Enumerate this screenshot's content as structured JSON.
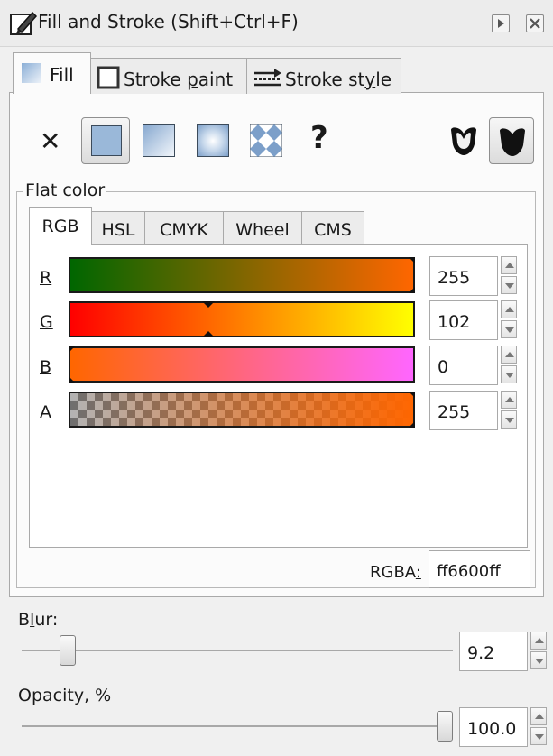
{
  "window": {
    "title": "Fill and Stroke (Shift+Ctrl+F)",
    "title_icon": "fill-stroke-pen-icon",
    "controls": [
      "dock-arrow-icon",
      "close-icon"
    ]
  },
  "tabs": [
    {
      "label": "Fill",
      "icon": "fill-gradient-icon",
      "active": true
    },
    {
      "label_pre": "Stroke ",
      "label_ul": "p",
      "label_post": "aint",
      "icon": "stroke-paint-icon",
      "active": false
    },
    {
      "label_pre": "Stroke st",
      "label_ul": "y",
      "label_post": "le",
      "icon": "stroke-style-icon",
      "active": false
    }
  ],
  "paint_types": [
    {
      "name": "no-paint",
      "glyph": "✕",
      "selected": false
    },
    {
      "name": "flat-color",
      "selected": true
    },
    {
      "name": "linear-gradient",
      "selected": false
    },
    {
      "name": "radial-gradient",
      "selected": false
    },
    {
      "name": "pattern",
      "selected": false
    },
    {
      "name": "unset",
      "glyph": "?",
      "selected": false
    }
  ],
  "fill_rules": [
    {
      "name": "evenodd-fill-rule",
      "selected": false
    },
    {
      "name": "nonzero-fill-rule",
      "selected": true
    }
  ],
  "flat_color_label": "Flat color",
  "color_tabs": [
    "RGB",
    "HSL",
    "CMYK",
    "Wheel",
    "CMS"
  ],
  "active_color_tab": "RGB",
  "channels": [
    {
      "label": "R",
      "value": "255"
    },
    {
      "label": "G",
      "value": "102"
    },
    {
      "label": "B",
      "value": "0"
    },
    {
      "label": "A",
      "value": "255"
    }
  ],
  "rgba": {
    "label": "RGBA",
    "value": "ff6600ff"
  },
  "blur": {
    "label_pre": "B",
    "label_ul": "l",
    "label_post": "ur:",
    "value": "9.2",
    "fraction": 0.092
  },
  "opacity": {
    "label": "Opacity, %",
    "value": "100.0",
    "fraction": 1.0
  },
  "colors": {
    "current": "#ff6600",
    "selection_blue": "#9ab8d9",
    "tab_bg": "#ececec"
  }
}
